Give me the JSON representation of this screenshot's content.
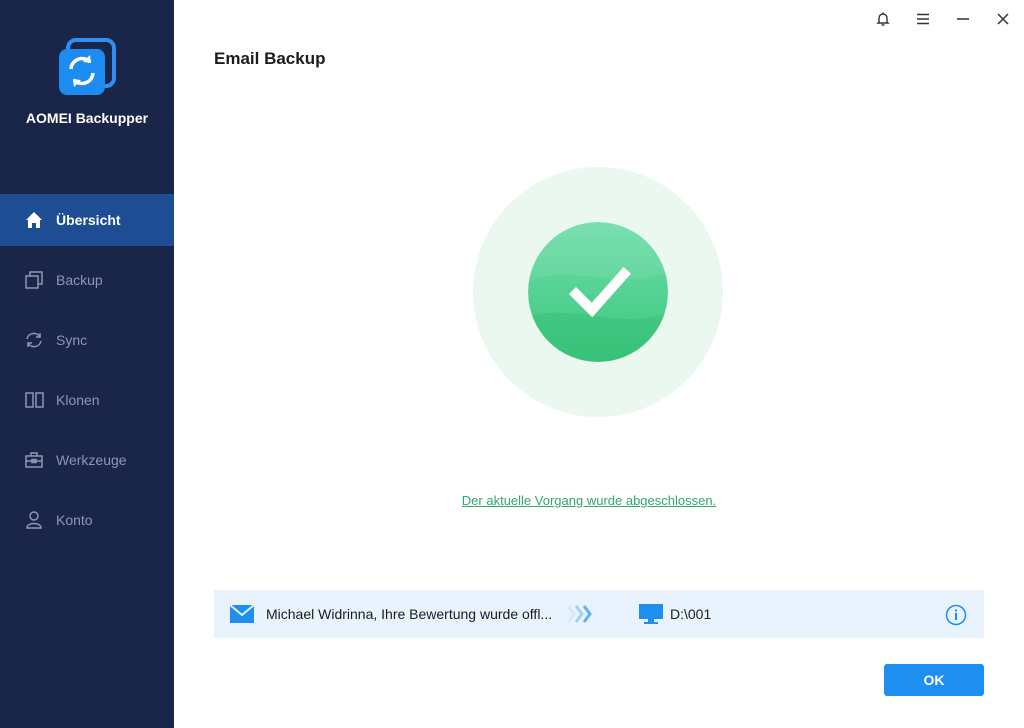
{
  "app": {
    "name": "AOMEI Backupper",
    "logo_icon": "aomei-backupper-logo-icon"
  },
  "sidebar": {
    "items": [
      {
        "label": "Übersicht",
        "icon": "home-icon",
        "active": true
      },
      {
        "label": "Backup",
        "icon": "backup-icon",
        "active": false
      },
      {
        "label": "Sync",
        "icon": "sync-icon",
        "active": false
      },
      {
        "label": "Klonen",
        "icon": "clone-icon",
        "active": false
      },
      {
        "label": "Werkzeuge",
        "icon": "toolbox-icon",
        "active": false
      },
      {
        "label": "Konto",
        "icon": "user-icon",
        "active": false
      }
    ]
  },
  "window_controls": [
    "bell-icon",
    "menu-icon",
    "minimize-icon",
    "close-icon"
  ],
  "page": {
    "title": "Email Backup",
    "status_message": "Der aktuelle Vorgang wurde abgeschlossen."
  },
  "task": {
    "source": "Michael Widrinna, Ihre Bewertung wurde offl...",
    "destination": "D:\\001",
    "source_icon": "mail-icon",
    "destination_icon": "computer-icon"
  },
  "buttons": {
    "ok_label": "OK"
  },
  "colors": {
    "sidebar_bg": "#1a2649",
    "sidebar_active": "#1f4d93",
    "accent": "#1e8ef0",
    "success": "#2fa86a"
  }
}
